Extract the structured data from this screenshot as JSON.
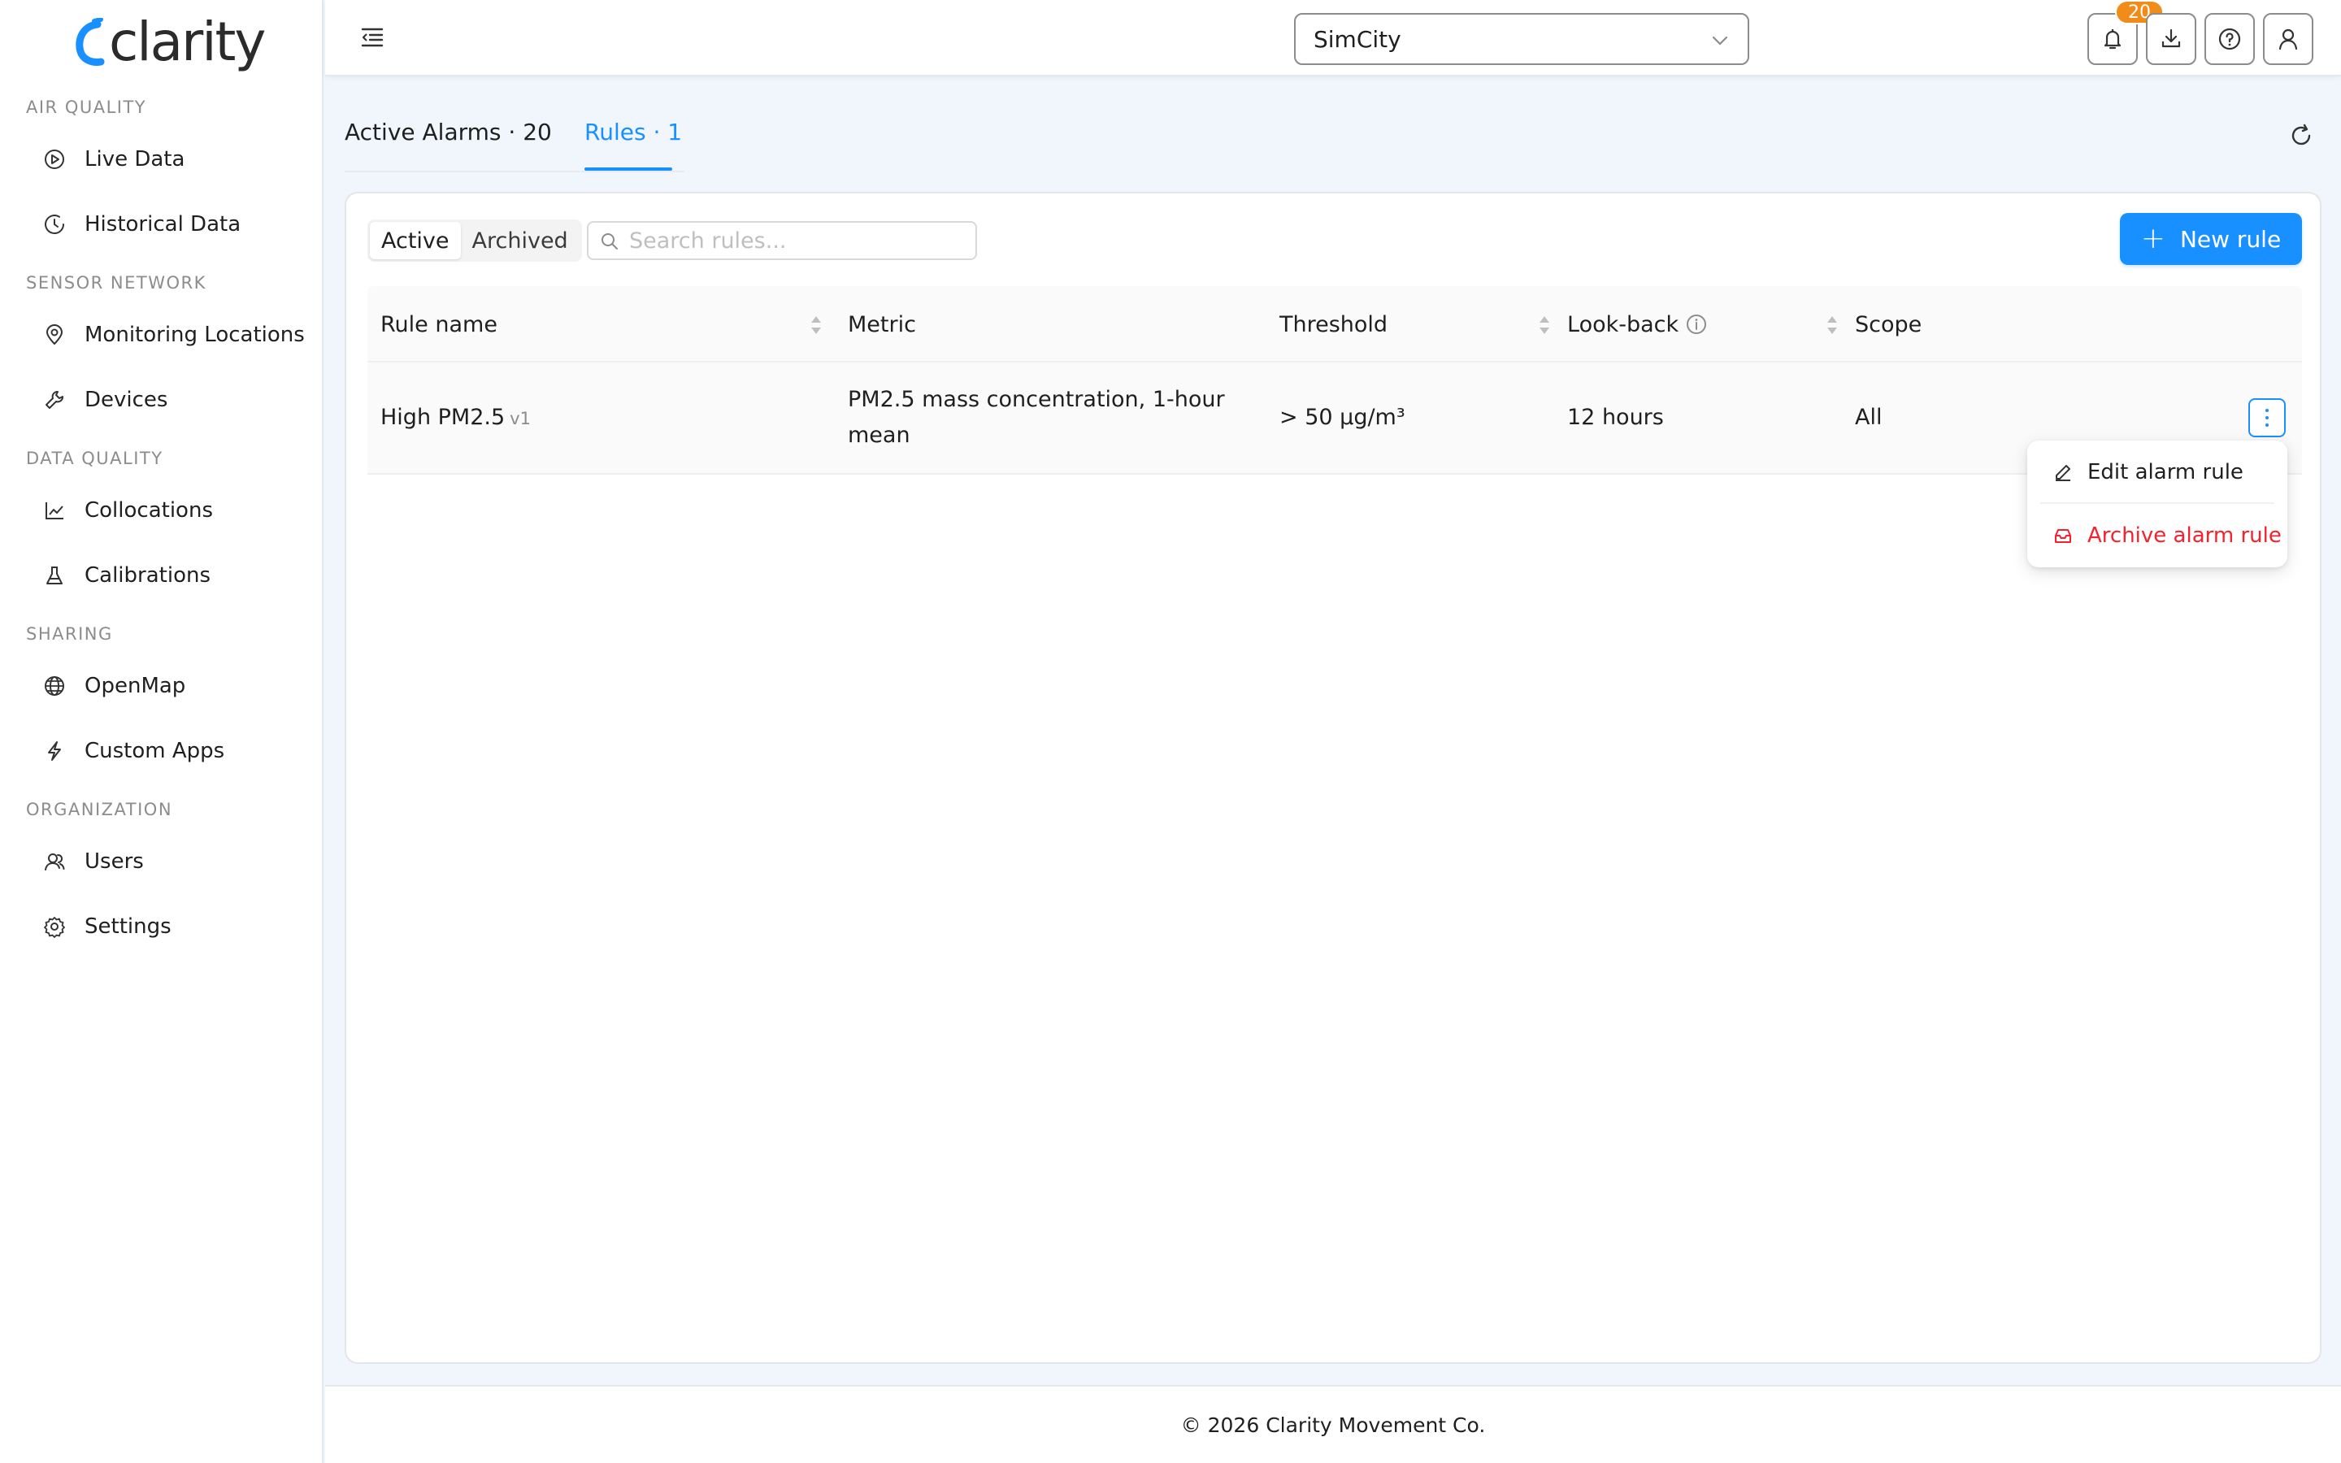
{
  "app": {
    "logo_text": "clarity",
    "brand_color": "#1890ff"
  },
  "sidebar": {
    "sections": [
      {
        "title": "AIR QUALITY",
        "items": [
          {
            "label": "Live Data",
            "icon": "play-circle-icon"
          },
          {
            "label": "Historical Data",
            "icon": "clock-icon"
          }
        ]
      },
      {
        "title": "SENSOR NETWORK",
        "items": [
          {
            "label": "Monitoring Locations",
            "icon": "location-pin-icon"
          },
          {
            "label": "Devices",
            "icon": "wrench-icon"
          }
        ]
      },
      {
        "title": "DATA QUALITY",
        "items": [
          {
            "label": "Collocations",
            "icon": "line-chart-icon"
          },
          {
            "label": "Calibrations",
            "icon": "flask-icon"
          }
        ]
      },
      {
        "title": "SHARING",
        "items": [
          {
            "label": "OpenMap",
            "icon": "globe-icon"
          },
          {
            "label": "Custom Apps",
            "icon": "lightning-icon"
          }
        ]
      },
      {
        "title": "ORGANIZATION",
        "items": [
          {
            "label": "Users",
            "icon": "users-icon"
          },
          {
            "label": "Settings",
            "icon": "gear-icon"
          }
        ]
      }
    ]
  },
  "header": {
    "org_selected": "SimCity",
    "notification_count": "20"
  },
  "tabs": [
    {
      "label": "Active Alarms · 20",
      "active": false
    },
    {
      "label": "Rules · 1",
      "active": true
    }
  ],
  "toolbar": {
    "filter_options": [
      "Active",
      "Archived"
    ],
    "filter_selected": "Active",
    "search_placeholder": "Search rules...",
    "new_rule_label": "New rule"
  },
  "table": {
    "columns": [
      "Rule name",
      "Metric",
      "Threshold",
      "Look-back",
      "Scope"
    ],
    "rows": [
      {
        "name": "High PM2.5",
        "version": "v1",
        "metric_line1": "PM2.5 mass concentration, 1-hour",
        "metric_line2": "mean",
        "threshold": "> 50 μg/m³",
        "lookback": "12 hours",
        "scope": "All"
      }
    ]
  },
  "row_menu": {
    "edit_label": "Edit alarm rule",
    "archive_label": "Archive alarm rule",
    "danger_color": "#f5222d"
  },
  "footer": {
    "text": "© 2026 Clarity Movement Co."
  }
}
